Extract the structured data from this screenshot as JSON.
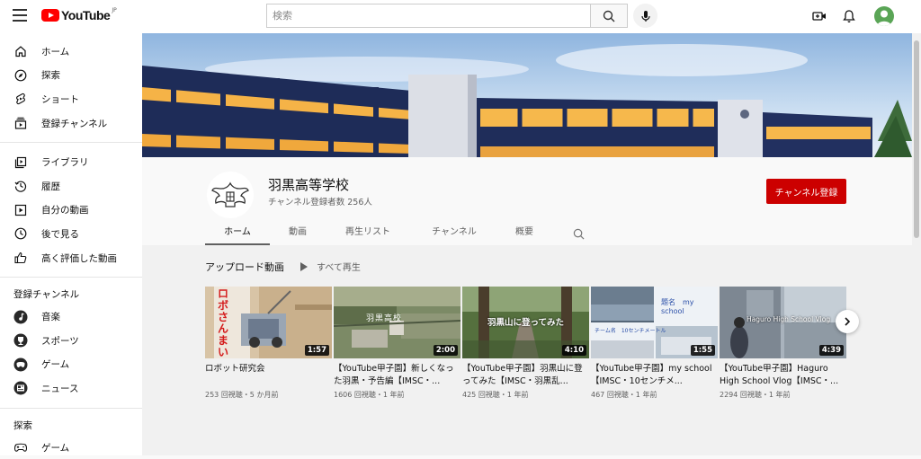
{
  "header": {
    "logo_text": "YouTube",
    "logo_region": "JP",
    "search_placeholder": "検索"
  },
  "sidebar": {
    "main": [
      {
        "label": "ホーム",
        "icon": "home-icon"
      },
      {
        "label": "探索",
        "icon": "compass-icon"
      },
      {
        "label": "ショート",
        "icon": "shorts-icon"
      },
      {
        "label": "登録チャンネル",
        "icon": "subscriptions-icon"
      }
    ],
    "library": [
      {
        "label": "ライブラリ",
        "icon": "library-icon"
      },
      {
        "label": "履歴",
        "icon": "history-icon"
      },
      {
        "label": "自分の動画",
        "icon": "your-videos-icon"
      },
      {
        "label": "後で見る",
        "icon": "clock-icon"
      },
      {
        "label": "高く評価した動画",
        "icon": "thumbs-up-icon"
      }
    ],
    "subscriptions_heading": "登録チャンネル",
    "subscriptions": [
      {
        "label": "音楽",
        "icon": "music-icon"
      },
      {
        "label": "スポーツ",
        "icon": "trophy-icon"
      },
      {
        "label": "ゲーム",
        "icon": "gaming-icon"
      },
      {
        "label": "ニュース",
        "icon": "news-icon"
      }
    ],
    "explore_heading": "探索",
    "explore": [
      {
        "label": "ゲーム",
        "icon": "gamepad-icon"
      }
    ]
  },
  "channel": {
    "name": "羽黒高等学校",
    "subscribers": "チャンネル登録者数 256人",
    "subscribe_label": "チャンネル登録",
    "tabs": [
      "ホーム",
      "動画",
      "再生リスト",
      "チャンネル",
      "概要"
    ]
  },
  "section": {
    "title": "アップロード動画",
    "play_all": "すべて再生"
  },
  "videos": [
    {
      "title": "ロボット研究会",
      "meta": "253 回視聴・5 か月前",
      "duration": "1:57",
      "overlay": "ロボさんまい"
    },
    {
      "title": "【YouTube甲子園】新しくなった羽黒・予告編【IMSC・...",
      "meta": "1606 回視聴・1 年前",
      "duration": "2:00",
      "overlay": "羽黒高校"
    },
    {
      "title": "【YouTube甲子園】羽黒山に登ってみた【IMSC・羽黒乱...",
      "meta": "425 回視聴・1 年前",
      "duration": "4:10",
      "overlay": "羽黒山に登ってみた"
    },
    {
      "title": "【YouTube甲子園】my school【IMSC・10センチメ...",
      "meta": "467 回視聴・1 年前",
      "duration": "1:55",
      "overlay": "題名　my school",
      "overlay2": "チーム名　10センチメートル"
    },
    {
      "title": "【YouTube甲子園】Haguro High School Vlog【IMSC・...",
      "meta": "2294 回視聴・1 年前",
      "duration": "4:39",
      "overlay": "Haguro High School Vlog"
    }
  ]
}
